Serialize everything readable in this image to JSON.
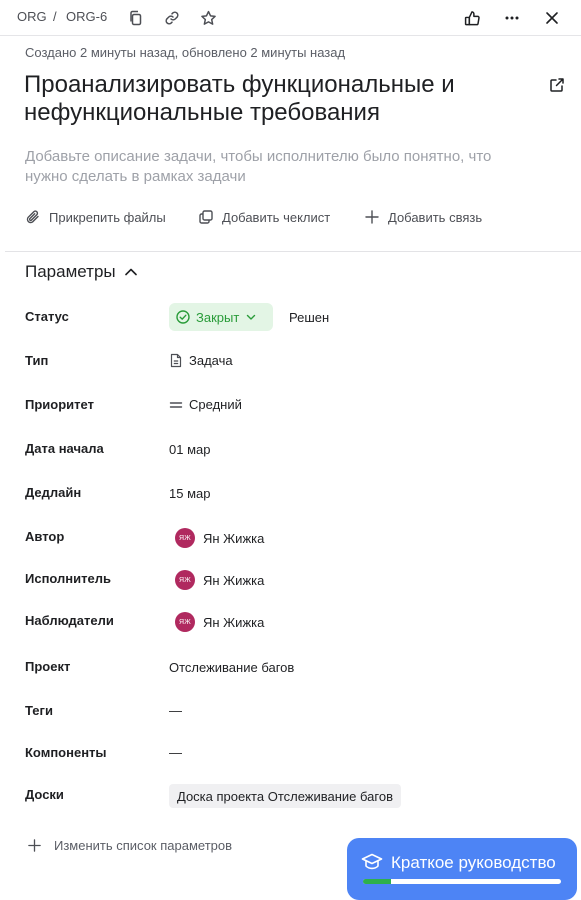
{
  "header": {
    "queue": "ORG",
    "separator": "/",
    "issue_key": "ORG-6"
  },
  "meta": "Создано 2 минуты назад, обновлено 2 минуты назад",
  "title": "Проанализировать функциональные и нефункциональные требования",
  "description_placeholder": "Добавьте описание задачи, чтобы исполнителю было понятно, что нужно сделать в рамках задачи",
  "actions": {
    "attach": "Прикрепить файлы",
    "checklist": "Добавить чеклист",
    "link": "Добавить связь"
  },
  "params": {
    "section_title": "Параметры",
    "status": {
      "label": "Статус",
      "value": "Закрыт",
      "resolution": "Решен"
    },
    "type": {
      "label": "Тип",
      "value": "Задача"
    },
    "priority": {
      "label": "Приоритет",
      "value": "Средний"
    },
    "start_date": {
      "label": "Дата начала",
      "value": "01 мар"
    },
    "deadline": {
      "label": "Дедлайн",
      "value": "15 мар"
    },
    "author": {
      "label": "Автор",
      "initials": "ЯЖ",
      "value": "Ян Жижка"
    },
    "assignee": {
      "label": "Исполнитель",
      "initials": "ЯЖ",
      "value": "Ян Жижка"
    },
    "followers": {
      "label": "Наблюдатели",
      "initials": "ЯЖ",
      "value": "Ян Жижка"
    },
    "project": {
      "label": "Проект",
      "value": "Отслеживание багов"
    },
    "tags": {
      "label": "Теги",
      "value": "—"
    },
    "components": {
      "label": "Компоненты",
      "value": "—"
    },
    "boards": {
      "label": "Доски",
      "value": "Доска проекта Отслеживание багов"
    },
    "change_list": "Изменить список параметров"
  },
  "guide": {
    "label": "Краткое руководство",
    "progress": 0.14
  },
  "colors": {
    "status_bg": "#e3f5e5",
    "status_text": "#2a9c3a",
    "avatar": "#b0295f",
    "guide_bg": "#4d84f5",
    "guide_progress": "#2eb04b"
  }
}
